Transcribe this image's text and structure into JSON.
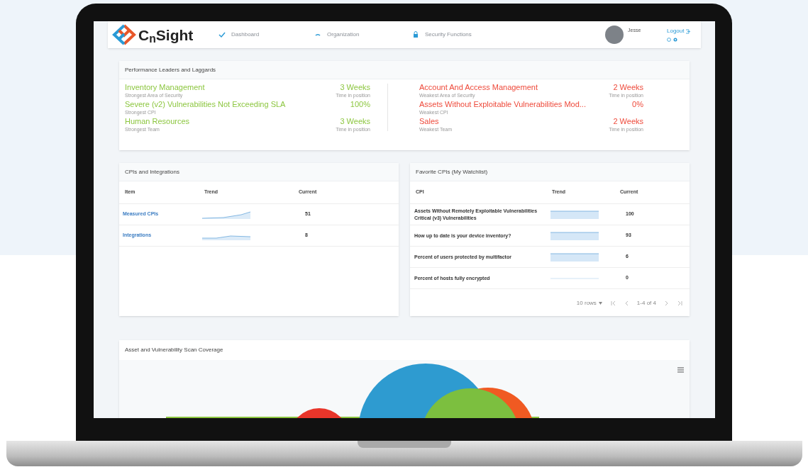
{
  "nav": {
    "logo": {
      "prefix": "C",
      "sub": "n",
      "rest": "Sight"
    },
    "items": [
      {
        "label": "Dashboard"
      },
      {
        "label": "Organization"
      },
      {
        "label": "Security Functions"
      }
    ],
    "user": "Jesse",
    "logout": "Logout"
  },
  "leaders": {
    "title": "Performance Leaders and Laggards",
    "strongest": [
      {
        "name": "Inventory Management",
        "caption": "Strongest Area of Security",
        "value": "3 Weeks",
        "value_caption": "Time in position"
      },
      {
        "name": "Severe (v2) Vulnerabilities Not Exceeding SLA",
        "caption": "Strongest CPI",
        "value": "100%"
      },
      {
        "name": "Human Resources",
        "caption": "Strongest Team",
        "value": "3 Weeks",
        "value_caption": "Time in position"
      }
    ],
    "weakest": [
      {
        "name": "Account And Access Management",
        "caption": "Weakest Area of Security",
        "value": "2 Weeks",
        "value_caption": "Time in position"
      },
      {
        "name": "Assets Without Exploitable Vulnerabilities Mod...",
        "caption": "Weakest CPI",
        "value": "0%"
      },
      {
        "name": "Sales",
        "caption": "Weakest Team",
        "value": "2 Weeks",
        "value_caption": "Time in position"
      }
    ]
  },
  "cpis": {
    "title": "CPIs and Integrations",
    "columns": [
      "Item",
      "Trend",
      "Current"
    ],
    "rows": [
      {
        "item": "Measured CPIs",
        "current": "51"
      },
      {
        "item": "Integrations",
        "current": "8"
      }
    ]
  },
  "watchlist": {
    "title": "Favorite CPIs (My Watchlist)",
    "columns": [
      "CPI",
      "Trend",
      "Current"
    ],
    "rows": [
      {
        "cpi": "Assets Without Remotely Exploitable Vulnerabilities Critical (v3) Vulnerabilities",
        "current": "100"
      },
      {
        "cpi": "How up to date is your device inventory?",
        "current": "93"
      },
      {
        "cpi": "Percent of users protected by multifactor",
        "current": "6"
      },
      {
        "cpi": "Percent of hosts fully encrypted",
        "current": "0"
      }
    ],
    "pager": {
      "rows": "10 rows",
      "range": "1-4 of 4"
    }
  },
  "coverage": {
    "title": "Asset and Vulnerability Scan Coverage"
  }
}
